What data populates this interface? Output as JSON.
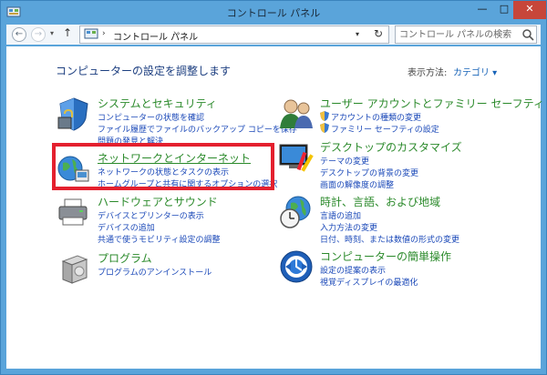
{
  "window": {
    "title": "コントロール パネル"
  },
  "nav": {
    "address_segment": "コントロール パネル",
    "search_placeholder": "コントロール パネルの検索"
  },
  "header": {
    "title": "コンピューターの設定を調整します",
    "view_by_label": "表示方法:",
    "view_by_value": "カテゴリ ▾"
  },
  "categories": [
    {
      "title": "システムとセキュリティ",
      "links": [
        "コンピューターの状態を確認",
        "ファイル履歴でファイルのバックアップ コピーを保存",
        "問題の発見と解決"
      ]
    },
    {
      "title": "ネットワークとインターネット",
      "links": [
        "ネットワークの状態とタスクの表示",
        "ホームグループと共有に関するオプションの選択"
      ]
    },
    {
      "title": "ハードウェアとサウンド",
      "links": [
        "デバイスとプリンターの表示",
        "デバイスの追加",
        "共通で使うモビリティ設定の調整"
      ]
    },
    {
      "title": "プログラム",
      "links": [
        "プログラムのアンインストール"
      ]
    },
    {
      "title": "ユーザー アカウントとファミリー セーフティ",
      "links": [
        "アカウントの種類の変更",
        "ファミリー セーフティの設定"
      ]
    },
    {
      "title": "デスクトップのカスタマイズ",
      "links": [
        "テーマの変更",
        "デスクトップの背景の変更",
        "画面の解像度の調整"
      ]
    },
    {
      "title": "時計、言語、および地域",
      "links": [
        "言語の追加",
        "入力方法の変更",
        "日付、時刻、または数値の形式の変更"
      ]
    },
    {
      "title": "コンピューターの簡単操作",
      "links": [
        "設定の提案の表示",
        "視覚ディスプレイの最適化"
      ]
    }
  ]
}
